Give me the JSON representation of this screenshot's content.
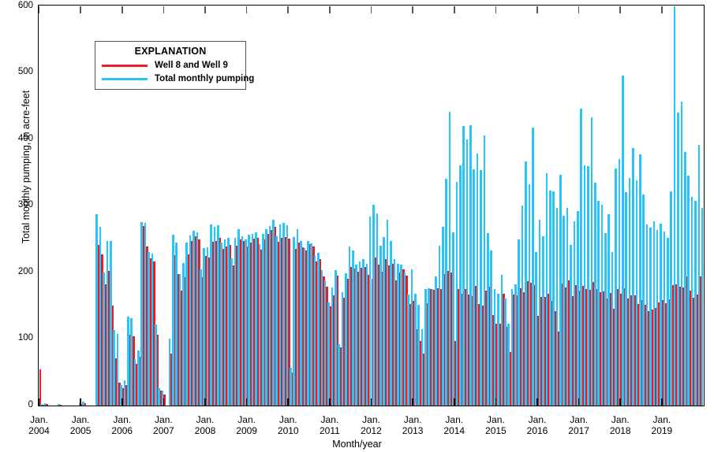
{
  "chart_data": {
    "type": "bar",
    "title": "",
    "xlabel": "Month/year",
    "ylabel": "Total monthly pumping, in acre-feet",
    "ylim": [
      0,
      600
    ],
    "yticks": [
      0,
      100,
      200,
      300,
      400,
      500,
      600
    ],
    "grid": false,
    "legend_position": "upper-left-inside",
    "legend_title": "EXPLANATION",
    "x_tick_labels": [
      {
        "month": "Jan.",
        "year": "2004"
      },
      {
        "month": "Jan.",
        "year": "2005"
      },
      {
        "month": "Jan.",
        "year": "2006"
      },
      {
        "month": "Jan.",
        "year": "2007"
      },
      {
        "month": "Jan.",
        "year": "2008"
      },
      {
        "month": "Jan.",
        "year": "2009"
      },
      {
        "month": "Jan.",
        "year": "2010"
      },
      {
        "month": "Jan.",
        "year": "2011"
      },
      {
        "month": "Jan.",
        "year": "2012"
      },
      {
        "month": "Jan.",
        "year": "2013"
      },
      {
        "month": "Jan.",
        "year": "2014"
      },
      {
        "month": "Jan.",
        "year": "2015"
      },
      {
        "month": "Jan.",
        "year": "2016"
      },
      {
        "month": "Jan.",
        "year": "2017"
      },
      {
        "month": "Jan.",
        "year": "2018"
      },
      {
        "month": "Jan.",
        "year": "2019"
      }
    ],
    "x_start": "2004-01",
    "x_end": "2019-01",
    "colors": {
      "wells": "#ED1C24",
      "total": "#29C5F6",
      "axis": "#000000"
    },
    "series": [
      {
        "name": "Total monthly pumping",
        "color": "#29C5F6",
        "values": [
          0,
          2,
          3,
          0,
          0,
          0,
          2,
          0,
          0,
          0,
          0,
          0,
          3,
          5,
          0,
          0,
          0,
          287,
          268,
          199,
          247,
          247,
          113,
          107,
          30,
          37,
          133,
          131,
          69,
          82,
          275,
          274,
          230,
          228,
          121,
          26,
          22,
          0,
          100,
          256,
          244,
          197,
          214,
          244,
          255,
          262,
          260,
          204,
          236,
          237,
          272,
          268,
          270,
          244,
          249,
          252,
          221,
          252,
          265,
          254,
          249,
          256,
          258,
          260,
          242,
          257,
          265,
          269,
          279,
          254,
          272,
          274,
          271,
          56,
          253,
          265,
          247,
          236,
          247,
          243,
          226,
          229,
          203,
          188,
          155,
          177,
          203,
          92,
          170,
          198,
          239,
          232,
          211,
          216,
          220,
          212,
          283,
          301,
          288,
          240,
          253,
          279,
          247,
          219,
          213,
          211,
          200,
          166,
          204,
          167,
          151,
          114,
          175,
          176,
          174,
          193,
          240,
          268,
          340,
          441,
          260,
          336,
          360,
          420,
          399,
          421,
          355,
          378,
          353,
          405,
          259,
          232,
          175,
          168,
          196,
          160,
          123,
          174,
          182,
          249,
          300,
          366,
          332,
          417,
          230,
          279,
          254,
          348,
          322,
          321,
          297,
          346,
          285,
          297,
          241,
          276,
          292,
          445,
          360,
          359,
          433,
          334,
          307,
          301,
          259,
          287,
          230,
          356,
          370,
          495,
          320,
          341,
          387,
          338,
          377,
          317,
          272,
          267,
          276,
          263,
          273,
          261,
          251,
          321,
          613,
          440,
          456,
          380,
          345,
          313,
          307,
          391,
          297
        ]
      },
      {
        "name": "Well 8 and Well 9",
        "color": "#ED1C24",
        "values": [
          54,
          1,
          2,
          0,
          0,
          0,
          1,
          0,
          0,
          0,
          0,
          0,
          2,
          3,
          0,
          0,
          0,
          241,
          227,
          182,
          202,
          150,
          71,
          34,
          26,
          30,
          106,
          103,
          62,
          73,
          269,
          239,
          221,
          216,
          106,
          22,
          16,
          0,
          77,
          226,
          197,
          172,
          192,
          227,
          247,
          254,
          249,
          192,
          224,
          222,
          246,
          247,
          252,
          235,
          238,
          241,
          210,
          240,
          249,
          247,
          239,
          244,
          250,
          251,
          234,
          249,
          257,
          263,
          268,
          245,
          252,
          253,
          250,
          49,
          235,
          244,
          237,
          232,
          242,
          238,
          216,
          220,
          194,
          178,
          148,
          165,
          195,
          87,
          161,
          190,
          208,
          205,
          201,
          206,
          208,
          196,
          190,
          222,
          211,
          201,
          219,
          210,
          212,
          188,
          200,
          204,
          195,
          152,
          157,
          114,
          96,
          78,
          153,
          175,
          173,
          176,
          175,
          197,
          202,
          199,
          96,
          175,
          167,
          174,
          166,
          164,
          179,
          152,
          150,
          172,
          178,
          135,
          122,
          123,
          167,
          118,
          80,
          166,
          165,
          176,
          170,
          186,
          184,
          180,
          134,
          163,
          163,
          168,
          157,
          141,
          111,
          183,
          177,
          188,
          164,
          180,
          172,
          179,
          175,
          173,
          185,
          175,
          170,
          171,
          160,
          169,
          145,
          174,
          168,
          176,
          160,
          165,
          165,
          152,
          158,
          151,
          142,
          144,
          146,
          155,
          158,
          153,
          159,
          180,
          182,
          178,
          177,
          193,
          172,
          162,
          166,
          193,
          161
        ]
      }
    ]
  },
  "axes": {
    "y_tick_labels": [
      "600",
      "500",
      "400",
      "300",
      "200",
      "100",
      "0"
    ],
    "y_axis_title": "Total monthly pumping, in acre-feet",
    "x_axis_title": "Month/year"
  },
  "legend": {
    "title": "EXPLANATION",
    "items": [
      {
        "label": "Well 8 and Well 9",
        "color": "#ED1C24"
      },
      {
        "label": "Total monthly pumping",
        "color": "#29C5F6"
      }
    ]
  }
}
